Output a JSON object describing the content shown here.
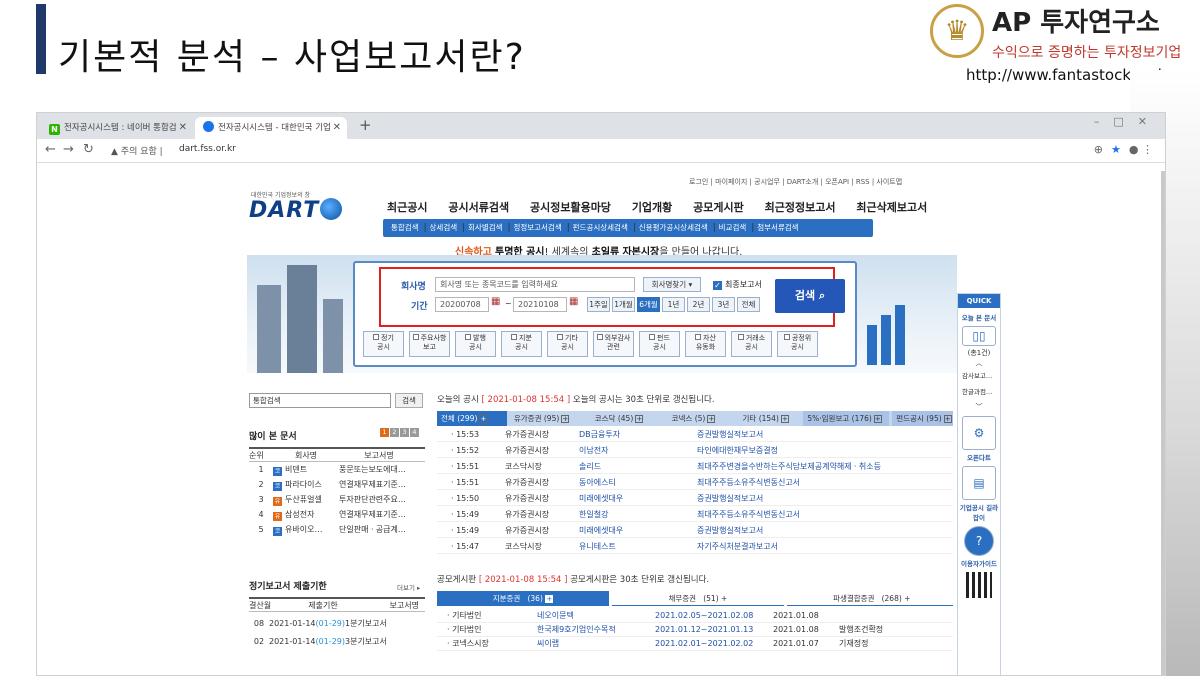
{
  "slide": {
    "title": "기본적 분석 – 사업보고서란?",
    "brand_name": "AP 투자연구소",
    "brand_slogan": "수익으로 증명하는 투자정보기업",
    "brand_url": "http://www.fantastock.co.kr"
  },
  "browser": {
    "tabs": [
      {
        "favicon": "N",
        "label": "전자공시시스템 : 네이버 통합검"
      },
      {
        "favicon": "dart-icon",
        "label": "전자공시시스템 - 대한민국 기업"
      }
    ],
    "new_tab": "+",
    "security_label": "주의 요함",
    "url": "dart.fss.or.kr"
  },
  "dart": {
    "top_links": "로그인 | 마이페이지 | 공시업무 | DART소개 | 오픈API | RSS | 사이트맵",
    "logo_small": "대한민국 기업정보의 창",
    "logo": "DART",
    "main_nav": [
      "최근공시",
      "공시서류검색",
      "공시정보활용마당",
      "기업개황",
      "공모게시판",
      "최근정정보고서",
      "최근삭제보고서"
    ],
    "sub_nav": [
      "통합검색",
      "상세검색",
      "회사별검색",
      "정정보고서검색",
      "펀드공시상세검색",
      "신용평가공시상세검색",
      "비교검색",
      "첨부서류검색"
    ],
    "tagline": {
      "hl": "신속하고",
      "b1": "투명한 공시",
      "rest": "! 세계속의 ",
      "b2": "초일류",
      "b3": "자본시장",
      "end": "을 만들어 나갑니다."
    },
    "search": {
      "company_label": "회사명",
      "company_placeholder": "회사명 또는 종목코드를 입력하세요",
      "find_company": "회사명찾기 ▾",
      "final_report": "최종보고서",
      "period_label": "기간",
      "date_from": "20200708",
      "date_to": "20210108",
      "periods": [
        "1주일",
        "1개월",
        "6개월",
        "1년",
        "2년",
        "3년",
        "전체"
      ],
      "active_period": "6개월",
      "search_btn": "검색",
      "categories": [
        [
          "정기",
          "공시"
        ],
        [
          "주요사항",
          "보고"
        ],
        [
          "발행",
          "공시"
        ],
        [
          "지분",
          "공시"
        ],
        [
          "기타",
          "공시"
        ],
        [
          "외부감사",
          "관련"
        ],
        [
          "펀드",
          "공시"
        ],
        [
          "자산",
          "유동화"
        ],
        [
          "거래소",
          "공시"
        ],
        [
          "공정위",
          "공시"
        ]
      ]
    },
    "quick": {
      "head": "QUICK",
      "today_docs": "오늘 본 문서",
      "count": "(총1건)",
      "docs": [
        "감사보고…",
        "한글과컴…"
      ],
      "opendart": "오픈다트",
      "disclosure_guide": "기업공시 길라잡이",
      "user_guide": "이용자가이드"
    },
    "left": {
      "search_placeholder": "통합검색",
      "search_btn": "검색",
      "popular_title": "많이 본 문서",
      "popular_pages": [
        "1",
        "2",
        "3",
        "4"
      ],
      "popular_headers": [
        "순위",
        "회사명",
        "보고서명"
      ],
      "popular_rows": [
        {
          "rank": "1",
          "mkt": "코",
          "mkt_color": "#2b6fc2",
          "company": "비덴트",
          "report": "풍문또는보도에대…"
        },
        {
          "rank": "2",
          "mkt": "코",
          "mkt_color": "#2b6fc2",
          "company": "파라다이스",
          "report": "연결재무제표기준…"
        },
        {
          "rank": "3",
          "mkt": "유",
          "mkt_color": "#e06a1c",
          "company": "두산퓨얼셀",
          "report": "투자판단관련주요…"
        },
        {
          "rank": "4",
          "mkt": "유",
          "mkt_color": "#e06a1c",
          "company": "삼성전자",
          "report": "연결재무제표기준…"
        },
        {
          "rank": "5",
          "mkt": "코",
          "mkt_color": "#2b6fc2",
          "company": "유바이오…",
          "report": "단일판매ㆍ공급계…"
        }
      ],
      "deadline_title": "정기보고서 제출기한",
      "more": "더보기 ▸",
      "deadline_headers": [
        "결산월",
        "제출기한",
        "보고서명"
      ],
      "deadline_rows": [
        {
          "month": "08",
          "date": "2021-01-14",
          "dday": "(01-29)",
          "report": "1분기보고서"
        },
        {
          "month": "02",
          "date": "2021-01-14",
          "dday": "(01-29)",
          "report": "3분기보고서"
        }
      ]
    },
    "today": {
      "label": "오늘의 공시",
      "stamp": "2021-01-08 15:54",
      "desc": "오늘의 공시는 30초 단위로 갱신됩니다.",
      "tabs": [
        {
          "name": "전체",
          "count": "(299)"
        },
        {
          "name": "유가증권",
          "count": "(95)"
        },
        {
          "name": "코스닥",
          "count": "(45)"
        },
        {
          "name": "코넥스",
          "count": "(5)"
        },
        {
          "name": "기타",
          "count": "(154)"
        },
        {
          "name": "5%·임원보고",
          "count": "(176)"
        },
        {
          "name": "펀드공시",
          "count": "(95)"
        }
      ],
      "rows": [
        {
          "time": "15:53",
          "market": "유가증권시장",
          "company": "DB금융투자",
          "report": "증권발행실적보고서"
        },
        {
          "time": "15:52",
          "market": "유가증권시장",
          "company": "이남전자",
          "report": "타인에대한채무보증결정"
        },
        {
          "time": "15:51",
          "market": "코스닥시장",
          "company": "솔리드",
          "report": "최대주주변경을수반하는주식담보제공계약해제ㆍ취소등"
        },
        {
          "time": "15:51",
          "market": "유가증권시장",
          "company": "동아에스티",
          "report": "최대주주등소유주식변동신고서"
        },
        {
          "time": "15:50",
          "market": "유가증권시장",
          "company": "미래에셋대우",
          "report": "증권발행실적보고서"
        },
        {
          "time": "15:49",
          "market": "유가증권시장",
          "company": "한일철강",
          "report": "최대주주등소유주식변동신고서"
        },
        {
          "time": "15:49",
          "market": "유가증권시장",
          "company": "미래에셋대우",
          "report": "증권발행실적보고서"
        },
        {
          "time": "15:47",
          "market": "코스닥시장",
          "company": "유니테스트",
          "report": "자기주식처분결과보고서"
        }
      ]
    },
    "board": {
      "label": "공모게시판",
      "stamp": "2021-01-08 15:54",
      "desc": "공모게시판은 30초 단위로 갱신됩니다.",
      "tabs": [
        {
          "name": "지분증권",
          "count": "(36)"
        },
        {
          "name": "채무증권",
          "count": "(51)"
        },
        {
          "name": "파생결합증권",
          "count": "(268)"
        }
      ],
      "rows": [
        {
          "type": "기타법인",
          "company": "네오이뮨텍",
          "period": "2021.02.05~2021.02.08",
          "date": "2021.01.08",
          "note": ""
        },
        {
          "type": "기타법인",
          "company": "한국제9호기업인수목적",
          "period": "2021.01.12~2021.01.13",
          "date": "2021.01.08",
          "note": "발행조건확정"
        },
        {
          "type": "코넥스시장",
          "company": "씨이랩",
          "period": "2021.02.01~2021.02.02",
          "date": "2021.01.07",
          "note": "기재정정"
        }
      ]
    }
  }
}
